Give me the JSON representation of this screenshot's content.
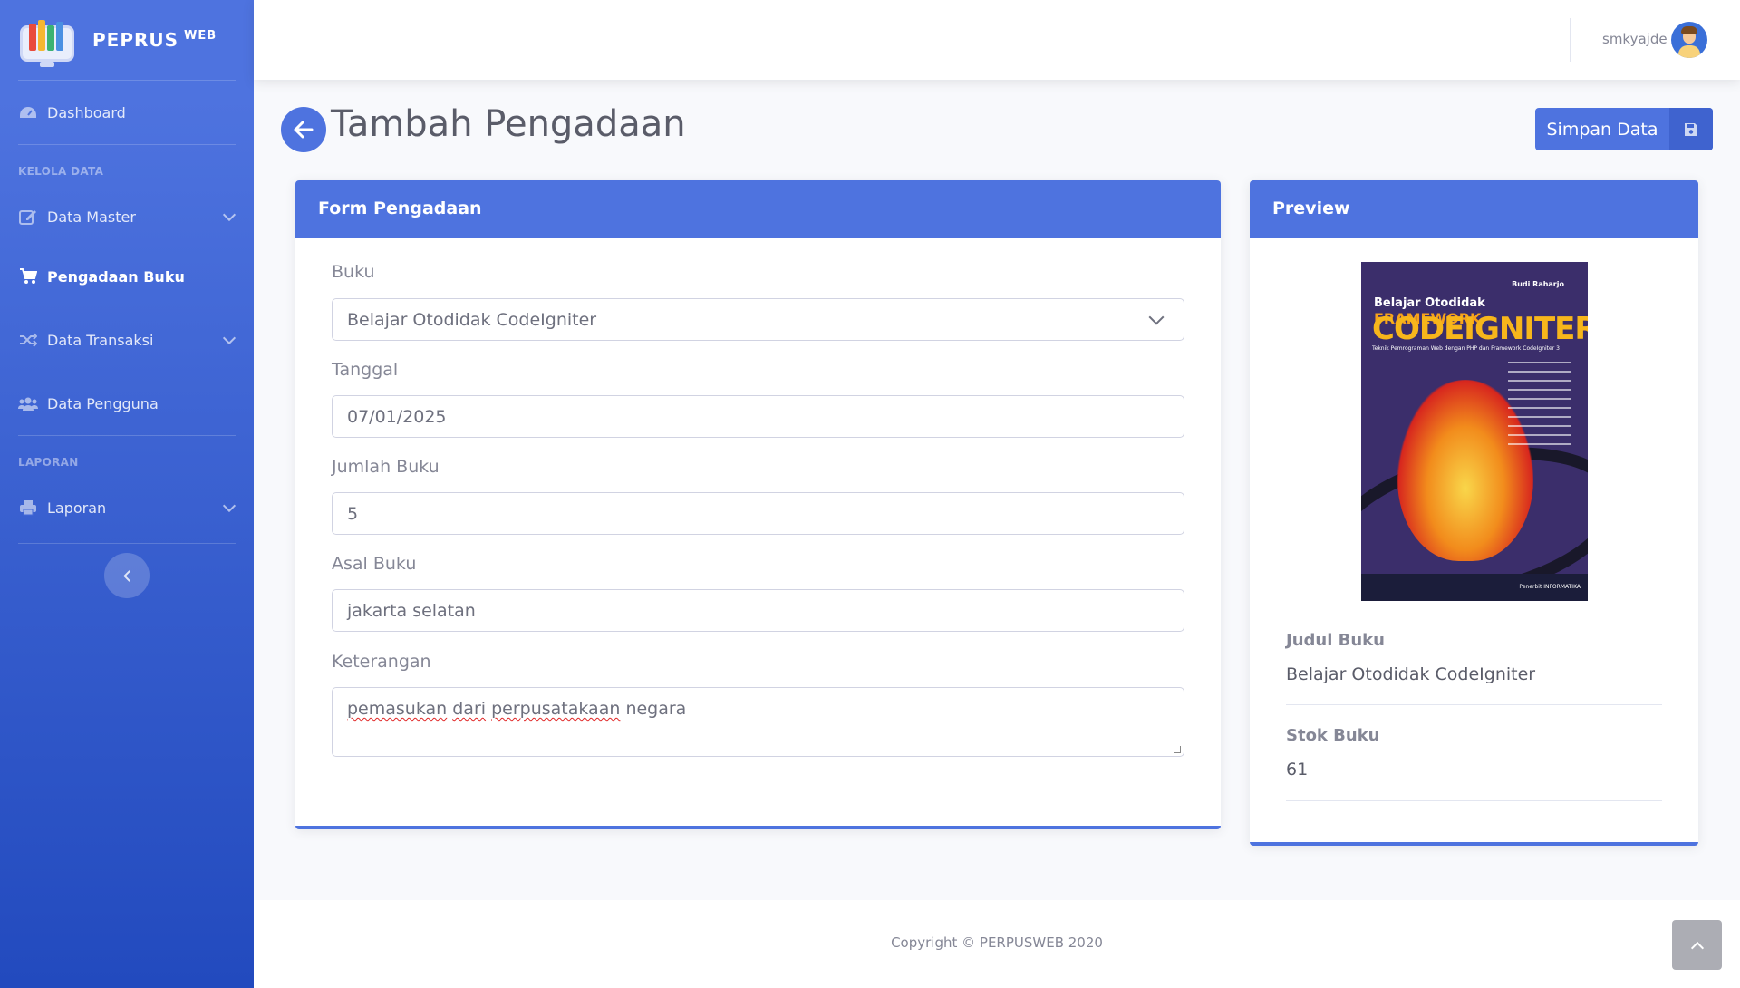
{
  "brand": {
    "name": "PEPRUS",
    "suffix": "WEB"
  },
  "sidebar": {
    "items": [
      {
        "label": "Dashboard",
        "icon": "tachometer-icon"
      },
      {
        "label": "Data Master",
        "icon": "edit-icon"
      },
      {
        "label": "Pengadaan Buku",
        "icon": "cart-icon",
        "active": true
      },
      {
        "label": "Data Transaksi",
        "icon": "random-icon"
      },
      {
        "label": "Data Pengguna",
        "icon": "users-icon"
      },
      {
        "label": "Laporan",
        "icon": "print-icon"
      }
    ],
    "headings": [
      "KELOLA DATA",
      "LAPORAN"
    ]
  },
  "topbar": {
    "username": "smkyajde"
  },
  "page": {
    "title": "Tambah Pengadaan",
    "save_label": "Simpan Data"
  },
  "form": {
    "header": "Form Pengadaan",
    "buku_label": "Buku",
    "buku_value": "Belajar Otodidak CodeIgniter",
    "tanggal_label": "Tanggal",
    "tanggal_value": "07/01/2025",
    "jumlah_label": "Jumlah Buku",
    "jumlah_value": "5",
    "asal_label": "Asal Buku",
    "asal_value": "jakarta selatan",
    "keterangan_label": "Keterangan",
    "keterangan_words": [
      "pemasukan",
      "dari",
      "perpusatakaan",
      "negara"
    ]
  },
  "preview": {
    "header": "Preview",
    "cover": {
      "author": "Budi Raharjo",
      "subtitle_a": "Belajar Otodidak",
      "subtitle_b": "FRAMEWORK",
      "title": "CODEIGNITER",
      "tagline": "Teknik Pemrograman Web dengan PHP dan Framework CodeIgniter 3",
      "publisher": "Penerbit INFORMATIKA"
    },
    "judul_label": "Judul Buku",
    "judul_value": "Belajar Otodidak CodeIgniter",
    "stok_label": "Stok Buku",
    "stok_value": "61"
  },
  "footer": {
    "copyright": "Copyright © PERPUSWEB 2020"
  },
  "colors": {
    "primary": "#4e73df",
    "sidebar_end": "#224abe"
  }
}
